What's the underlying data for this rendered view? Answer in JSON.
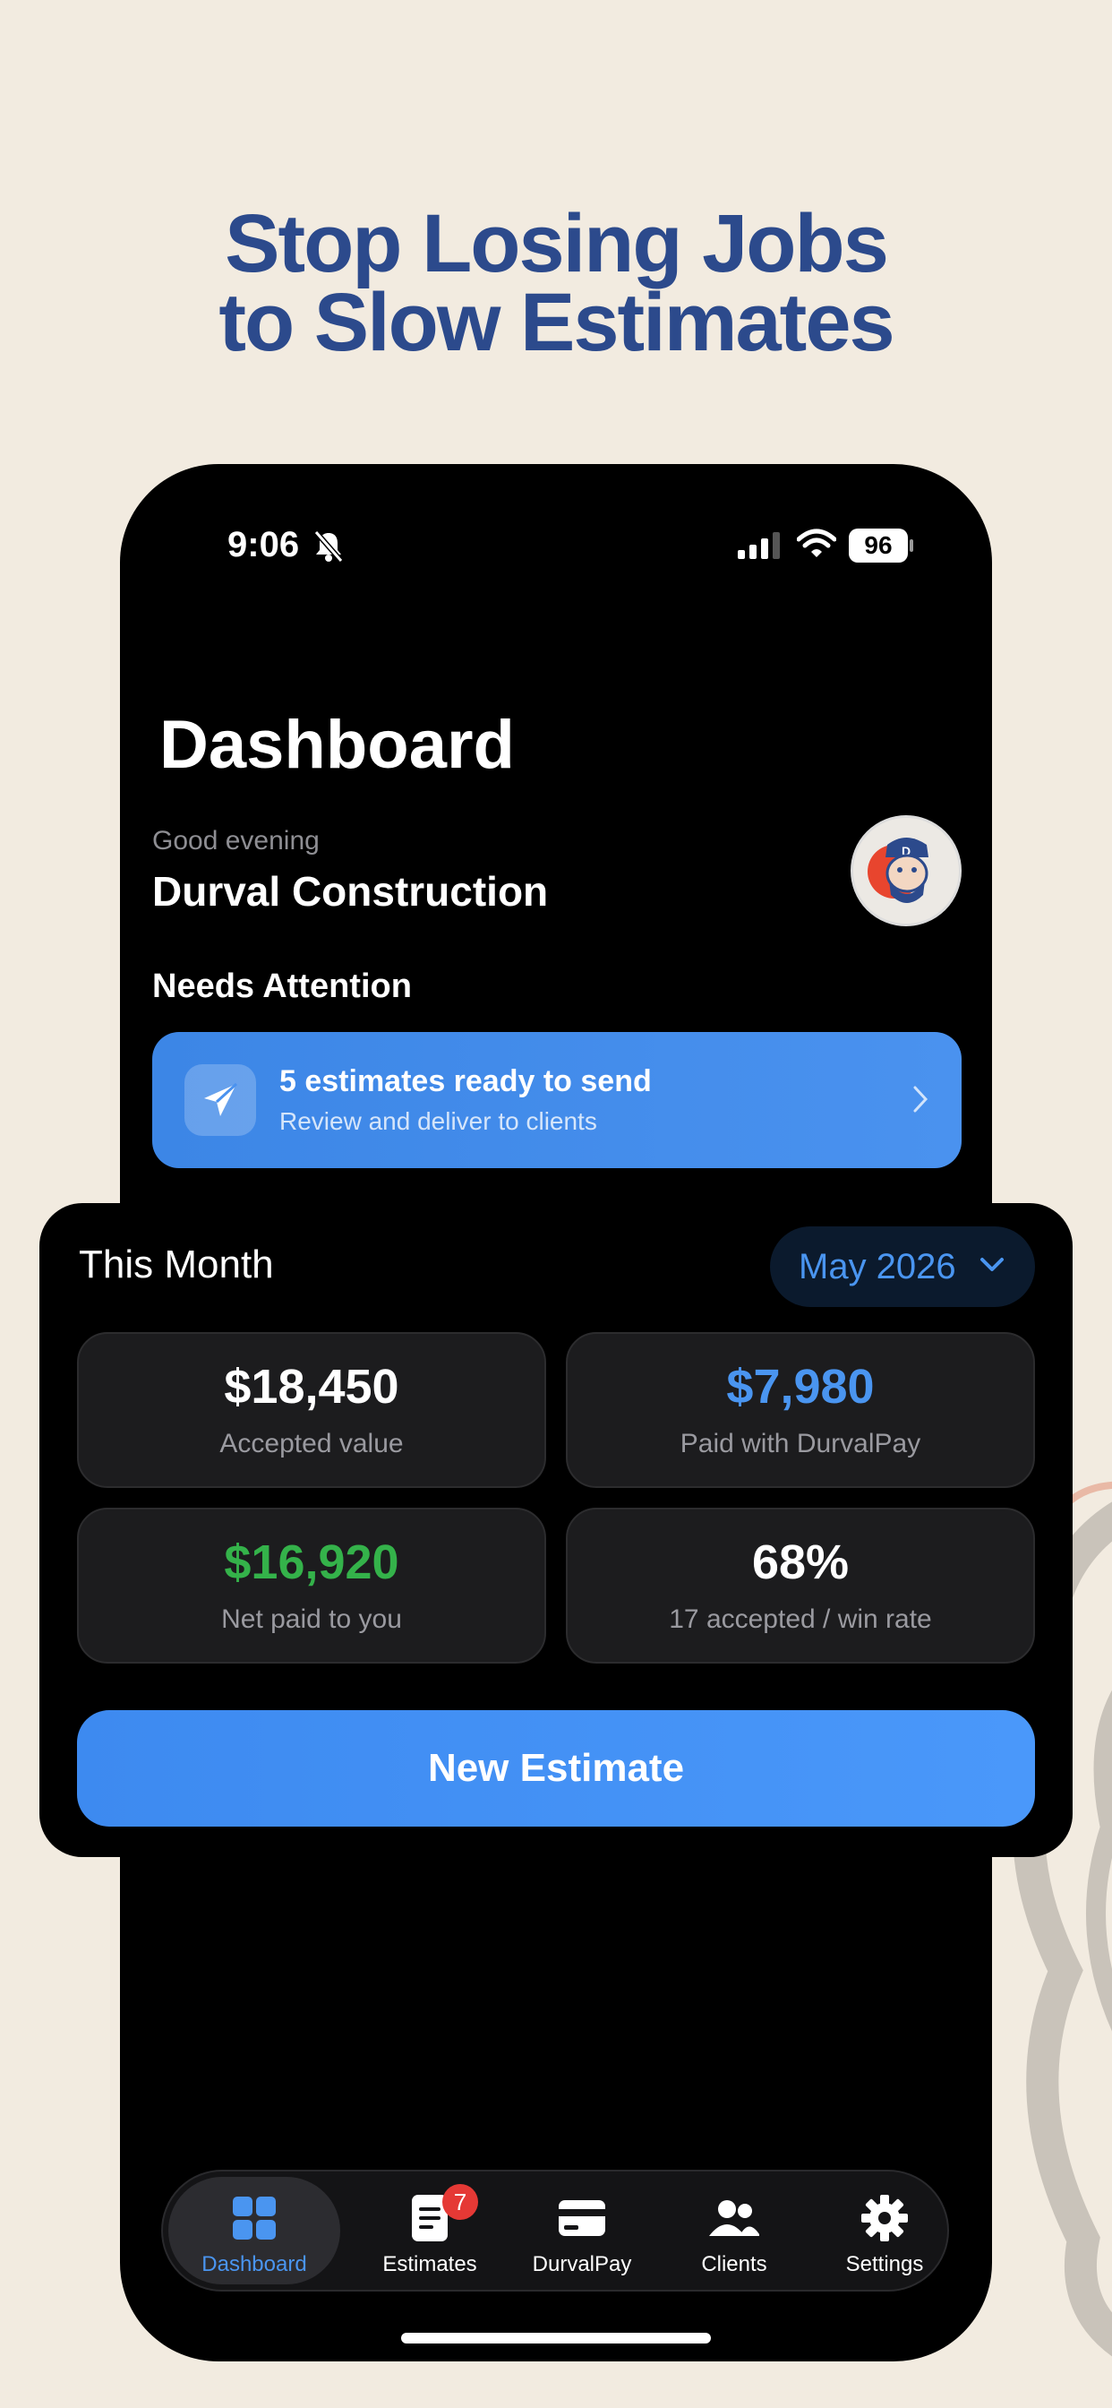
{
  "headline": {
    "line1": "Stop Losing Jobs",
    "line2": "to Slow Estimates"
  },
  "status_bar": {
    "time": "9:06",
    "battery": "96"
  },
  "page": {
    "title": "Dashboard",
    "greeting": "Good evening",
    "company": "Durval Construction"
  },
  "attention": {
    "heading": "Needs Attention",
    "card_title": "5 estimates ready to send",
    "card_subtitle": "Review and deliver to clients"
  },
  "this_month": {
    "title": "This Month",
    "period": "May 2026",
    "stats": [
      {
        "value": "$18,450",
        "label": "Accepted value",
        "color": "#ffffff"
      },
      {
        "value": "$7,980",
        "label": "Paid with DurvalPay",
        "color": "#4a95f0"
      },
      {
        "value": "$16,920",
        "label": "Net paid to you",
        "color": "#34b24a"
      },
      {
        "value": "68%",
        "label": "17 accepted / win rate",
        "color": "#ffffff"
      }
    ],
    "new_estimate_label": "New Estimate"
  },
  "tabbar": {
    "tabs": [
      {
        "label": "Dashboard",
        "icon": "grid-icon",
        "active": true
      },
      {
        "label": "Estimates",
        "icon": "document-icon",
        "badge": "7"
      },
      {
        "label": "DurvalPay",
        "icon": "card-icon"
      },
      {
        "label": "Clients",
        "icon": "people-icon"
      },
      {
        "label": "Settings",
        "icon": "gear-icon"
      }
    ]
  },
  "colors": {
    "accent": "#4a95f0",
    "background": "#f2ebe0",
    "headline": "#2c4a8c",
    "positive": "#34b24a",
    "badge": "#e53935"
  }
}
